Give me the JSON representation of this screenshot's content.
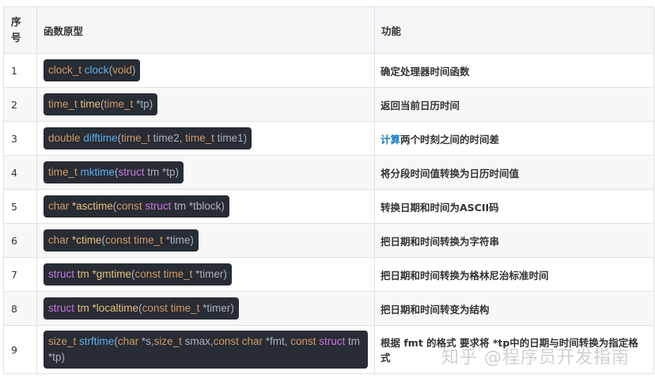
{
  "headers": {
    "num": "序号",
    "prototype": "函数原型",
    "function": "功能"
  },
  "rows": [
    {
      "num": "1",
      "desc": "确定处理器时间函数",
      "code": [
        [
          "t",
          "clock_t"
        ],
        [
          "p",
          " "
        ],
        [
          "f",
          "clock"
        ],
        [
          "p",
          "("
        ],
        [
          "t",
          "void"
        ],
        [
          "p",
          ")"
        ]
      ]
    },
    {
      "num": "2",
      "desc": "返回当前日历时间",
      "code": [
        [
          "t",
          "time_t"
        ],
        [
          "p",
          " "
        ],
        [
          "fn-y",
          "time"
        ],
        [
          "p",
          "("
        ],
        [
          "t",
          "time_t"
        ],
        [
          "p",
          " *tp)"
        ]
      ]
    },
    {
      "num": "3",
      "desc_link": "计算",
      "desc": "两个时刻之间的时间差",
      "code": [
        [
          "t",
          "double"
        ],
        [
          "p",
          " "
        ],
        [
          "f",
          "difftime"
        ],
        [
          "p",
          "("
        ],
        [
          "t",
          "time_t"
        ],
        [
          "p",
          " time2, "
        ],
        [
          "t",
          "time_t"
        ],
        [
          "p",
          " time1)"
        ]
      ]
    },
    {
      "num": "4",
      "desc": "将分段时间值转换为日历时间值",
      "code": [
        [
          "t",
          "time_t"
        ],
        [
          "p",
          " "
        ],
        [
          "f",
          "mktime"
        ],
        [
          "p",
          "("
        ],
        [
          "s",
          "struct"
        ],
        [
          "p",
          " tm *tp)"
        ]
      ]
    },
    {
      "num": "5",
      "desc": "转换日期和时间为ASCII码",
      "code": [
        [
          "t",
          "char"
        ],
        [
          "p",
          " "
        ],
        [
          "fn-y",
          "*asctime"
        ],
        [
          "p",
          "("
        ],
        [
          "t",
          "const"
        ],
        [
          "p",
          " "
        ],
        [
          "s",
          "struct"
        ],
        [
          "p",
          " tm *tblock)"
        ]
      ]
    },
    {
      "num": "6",
      "desc": "把日期和时间转换为字符串",
      "code": [
        [
          "t",
          "char"
        ],
        [
          "p",
          " "
        ],
        [
          "fn-y",
          "*ctime"
        ],
        [
          "p",
          "("
        ],
        [
          "t",
          "const"
        ],
        [
          "p",
          " "
        ],
        [
          "t",
          "time_t"
        ],
        [
          "p",
          " *time)"
        ]
      ]
    },
    {
      "num": "7",
      "desc": "把日期和时间转换为格林尼治标准时间",
      "code": [
        [
          "s",
          "struct"
        ],
        [
          "p",
          " "
        ],
        [
          "fn-y",
          "tm *gmtime"
        ],
        [
          "p",
          "("
        ],
        [
          "t",
          "const"
        ],
        [
          "p",
          " "
        ],
        [
          "t",
          "time_t"
        ],
        [
          "p",
          " *timer)"
        ]
      ]
    },
    {
      "num": "8",
      "desc": "把日期和时间转变为结构",
      "code": [
        [
          "s",
          "struct"
        ],
        [
          "p",
          " "
        ],
        [
          "fn-y",
          "tm *localtime"
        ],
        [
          "p",
          "("
        ],
        [
          "t",
          "const"
        ],
        [
          "p",
          " "
        ],
        [
          "t",
          "time_t"
        ],
        [
          "p",
          " *timer)"
        ]
      ]
    },
    {
      "num": "9",
      "desc": "根据 fmt 的格式 要求将 *tp中的日期与时间转换为指定格式",
      "code": [
        [
          "t",
          "size_t"
        ],
        [
          "p",
          " "
        ],
        [
          "f",
          "strftime"
        ],
        [
          "p",
          "("
        ],
        [
          "t",
          "char"
        ],
        [
          "p",
          " *s,"
        ],
        [
          "t",
          "size_t"
        ],
        [
          "p",
          " smax,"
        ],
        [
          "t",
          "const"
        ],
        [
          "p",
          " "
        ],
        [
          "t",
          "char"
        ],
        [
          "p",
          " *fmt, "
        ],
        [
          "t",
          "const"
        ],
        [
          "p",
          " "
        ],
        [
          "s",
          "struct"
        ],
        [
          "p",
          " tm *tp)"
        ]
      ]
    }
  ],
  "watermark": "知乎 @程序员开发指南"
}
